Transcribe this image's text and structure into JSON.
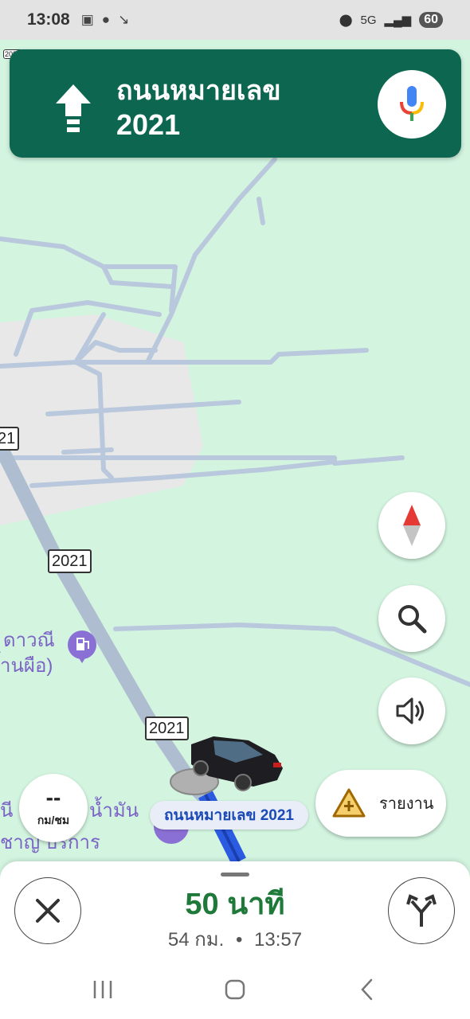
{
  "status_bar": {
    "time": "13:08",
    "icons": [
      "screenshot-icon",
      "line-icon",
      "missed-call-icon"
    ],
    "network": "5G",
    "battery": "60"
  },
  "navigation": {
    "direction_icon": "arrow-up-icon",
    "street": "ถนนหมายเลข",
    "route_number": "2021"
  },
  "map": {
    "route_shields": [
      "21",
      "2021",
      "2021"
    ],
    "top_left_shield": "2021",
    "poi_name_line1": "ดาวณี",
    "poi_name_line2": "้านผือ)",
    "poi_bottom_line1": "นี",
    "poi_bottom_line1b": "น้ำมัน",
    "poi_bottom_line2": "ชาญ   บริการ",
    "current_road_label": "ถนนหมายเลข 2021",
    "speed_value": "--",
    "speed_unit": "กม/ชม"
  },
  "controls": {
    "compass": "compass-icon",
    "search": "search-icon",
    "sound": "volume-icon",
    "report_label": "รายงาน"
  },
  "trip": {
    "eta_duration": "50 นาที",
    "distance": "54 กม.",
    "separator": "•",
    "arrival_time": "13:57"
  },
  "colors": {
    "banner": "#0c6650",
    "map_bg": "#d3f5e0",
    "route": "#2b5be0",
    "eta_green": "#1f7a3a"
  }
}
